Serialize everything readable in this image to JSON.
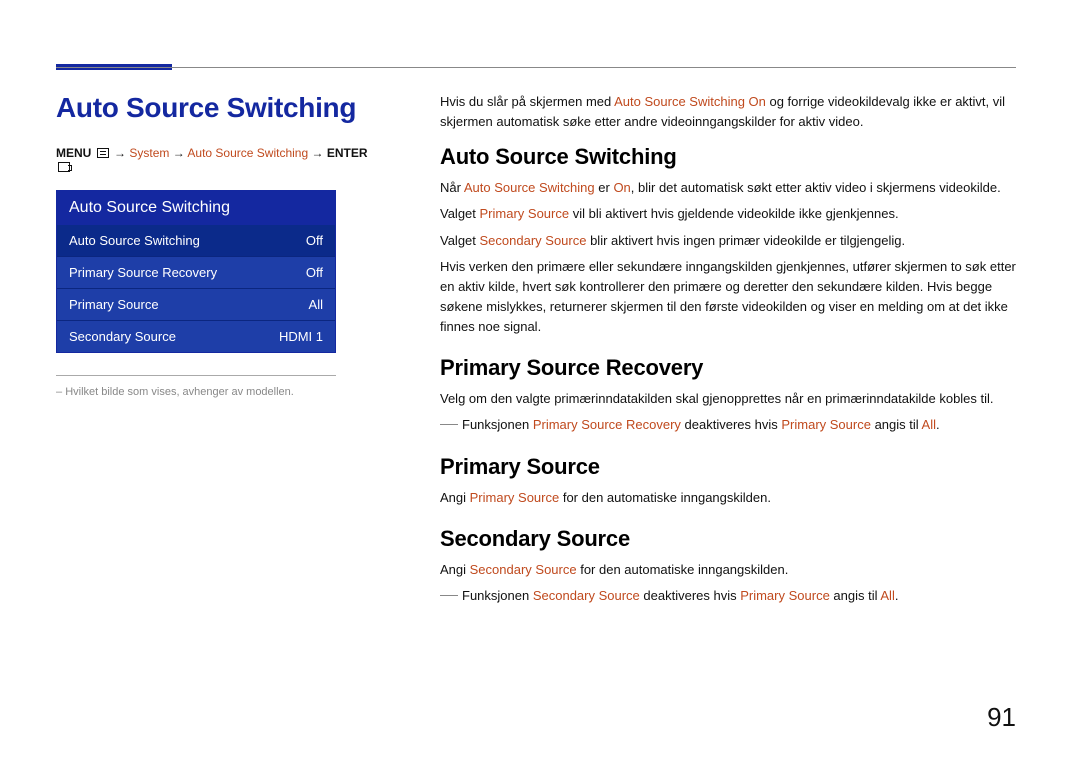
{
  "title": "Auto Source Switching",
  "breadcrumb": {
    "menu": "MENU",
    "system": "System",
    "auto": "Auto Source Switching",
    "enter": "ENTER",
    "arrow": "→"
  },
  "panel": {
    "title": "Auto Source Switching",
    "rows": [
      {
        "label": "Auto Source Switching",
        "value": "Off"
      },
      {
        "label": "Primary Source Recovery",
        "value": "Off"
      },
      {
        "label": "Primary Source",
        "value": "All"
      },
      {
        "label": "Secondary Source",
        "value": "HDMI 1"
      }
    ]
  },
  "caption": "Hvilket bilde som vises, avhenger av modellen.",
  "intro": {
    "p1a": "Hvis du slår på skjermen med ",
    "p1h": "Auto Source Switching On",
    "p1b": " og forrige videokildevalg ikke er aktivt, vil skjermen automatisk søke etter andre videoinngangskilder for aktiv video."
  },
  "s1": {
    "title": "Auto Source Switching",
    "p1a": "Når ",
    "p1h1": "Auto Source Switching",
    "p1b": " er ",
    "p1h2": "On",
    "p1c": ", blir det automatisk søkt etter aktiv video i skjermens videokilde.",
    "p2a": "Valget ",
    "p2h": "Primary Source",
    "p2b": " vil bli aktivert hvis gjeldende videokilde ikke gjenkjennes.",
    "p3a": "Valget ",
    "p3h": "Secondary Source",
    "p3b": " blir aktivert hvis ingen primær videokilde er tilgjengelig.",
    "p4": "Hvis verken den primære eller sekundære inngangskilden gjenkjennes, utfører skjermen to søk etter en aktiv kilde, hvert søk kontrollerer den primære og deretter den sekundære kilden. Hvis begge søkene mislykkes, returnerer skjermen til den første videokilden og viser en melding om at det ikke finnes noe signal."
  },
  "s2": {
    "title": "Primary Source Recovery",
    "p1": "Velg om den valgte primærinndatakilden skal gjenopprettes når en primærinndatakilde kobles til.",
    "note_a": "Funksjonen ",
    "note_h1": "Primary Source Recovery",
    "note_b": " deaktiveres hvis ",
    "note_h2": "Primary Source",
    "note_c": " angis til ",
    "note_h3": "All",
    "note_d": "."
  },
  "s3": {
    "title": "Primary Source",
    "p1a": "Angi ",
    "p1h": "Primary Source",
    "p1b": " for den automatiske inngangskilden."
  },
  "s4": {
    "title": "Secondary Source",
    "p1a": "Angi ",
    "p1h": "Secondary Source",
    "p1b": " for den automatiske inngangskilden.",
    "note_a": "Funksjonen ",
    "note_h1": "Secondary Source",
    "note_b": " deaktiveres hvis ",
    "note_h2": "Primary Source",
    "note_c": " angis til ",
    "note_h3": "All",
    "note_d": "."
  },
  "page_number": "91"
}
